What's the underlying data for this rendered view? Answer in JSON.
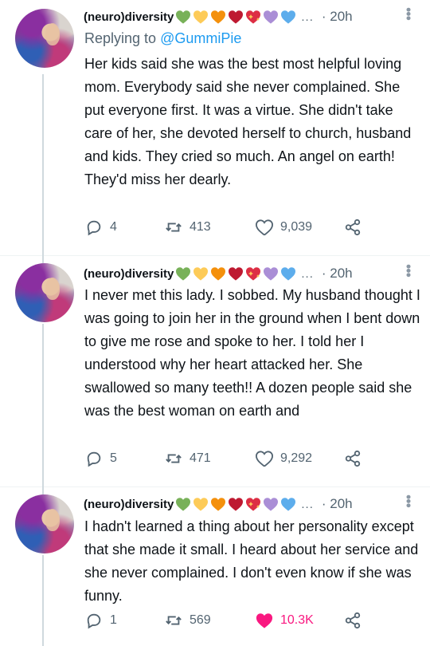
{
  "tweets": [
    {
      "name": "(neuro)diversity",
      "time": "· 20h",
      "reply_to_prefix": "Replying to ",
      "reply_to_handle": "@GummiPie",
      "text": "Her kids said she was the best most helpful loving mom. Everybody said she never complained. She put everyone first. It was a virtue. She didn't take care of her, she devoted herself to church, husband and kids. They cried so much. An angel on earth! They'd miss her dearly.",
      "replies": "4",
      "retweets": "413",
      "likes": "9,039",
      "liked": false
    },
    {
      "name": "(neuro)diversity",
      "time": "· 20h",
      "text": "I never met this lady. I sobbed. My husband thought I was going to join her in the ground when I bent down to give me rose and spoke to her. I told her I understood why her heart attacked her. She swallowed so many teeth!! A  dozen people said she was the best woman on earth and",
      "replies": "5",
      "retweets": "471",
      "likes": "9,292",
      "liked": false
    },
    {
      "name": "(neuro)diversity",
      "time": "· 20h",
      "text": "I hadn't learned a thing about her personality except that she made it small. I heard about her service and she never complained. I don't even know if she was funny.",
      "replies": "1",
      "retweets": "569",
      "likes": "10.3K",
      "liked": true
    }
  ],
  "name_emojis": [
    "green-heart",
    "yellow-heart",
    "orange-heart",
    "red-heart",
    "sparkling-heart",
    "purple-heart",
    "blue-heart"
  ],
  "ellipsis": "...",
  "colors": {
    "secondary_text": "#536471",
    "link": "#1d9bf0",
    "like_active": "#f91880",
    "heart_green": "#78b159",
    "heart_yellow": "#fdcb58",
    "heart_orange": "#f4900c",
    "heart_red": "#dd2e44",
    "heart_purple": "#aa8ed6",
    "heart_blue": "#5dadec"
  }
}
